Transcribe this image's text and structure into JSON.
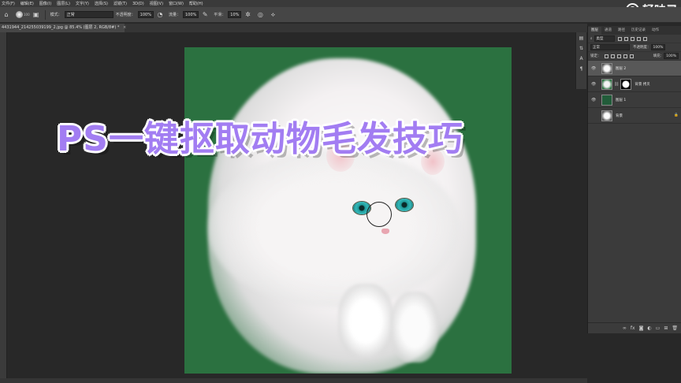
{
  "menu": [
    "文件(F)",
    "编辑(E)",
    "图像(I)",
    "图层(L)",
    "文字(Y)",
    "选择(S)",
    "滤镜(T)",
    "3D(D)",
    "视图(V)",
    "窗口(W)",
    "帮助(H)"
  ],
  "options": {
    "brush_size": "100",
    "mode_label": "模式：",
    "mode_value": "正常",
    "opacity_label": "不透明度：",
    "opacity_value": "100%",
    "flow_label": "流量：",
    "flow_value": "100%",
    "smoothing_label": "平滑：",
    "smoothing_value": "10%"
  },
  "tab": {
    "title": "4431944_214255039199_2.jpg @ 85.4% (图层 2, RGB/8#) *",
    "close": "×"
  },
  "headline": "PS一键抠取动物毛发技巧",
  "watermark": "轻映录",
  "layers_panel": {
    "tabs": [
      "图层",
      "通道",
      "路径",
      "历史记录",
      "动作"
    ],
    "filter_label": "类型",
    "blend_mode": "正常",
    "opacity_label": "不透明度：",
    "opacity_value": "100%",
    "lock_label": "锁定：",
    "fill_label": "填充：",
    "fill_value": "100%",
    "layers": [
      {
        "name": "图层 2"
      },
      {
        "name": "背景 拷贝"
      },
      {
        "name": "图层 1"
      },
      {
        "name": "背景"
      }
    ],
    "footer_icons": [
      "link-icon",
      "fx-icon",
      "mask-icon",
      "adjustment-icon",
      "group-icon",
      "new-layer-icon",
      "trash-icon"
    ]
  }
}
